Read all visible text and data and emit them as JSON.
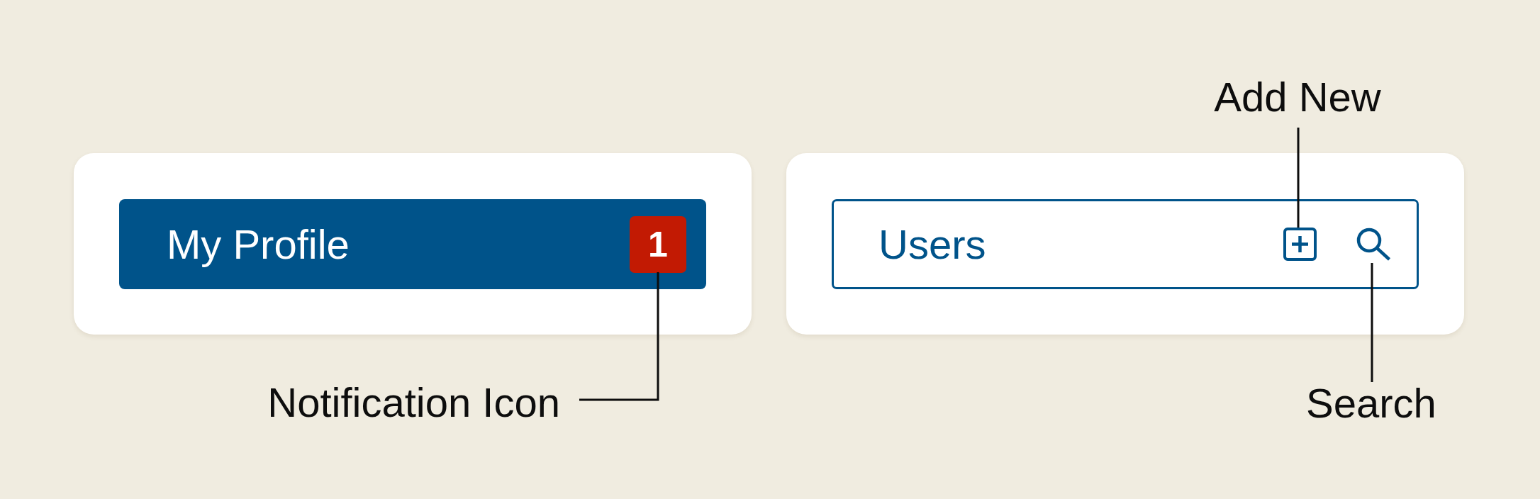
{
  "nav_item": {
    "label": "My Profile",
    "badge": "1"
  },
  "section_header": {
    "title": "Users"
  },
  "annotations": [
    {
      "label": "Add New"
    },
    {
      "label": "Notification Icon"
    },
    {
      "label": "Search"
    }
  ]
}
